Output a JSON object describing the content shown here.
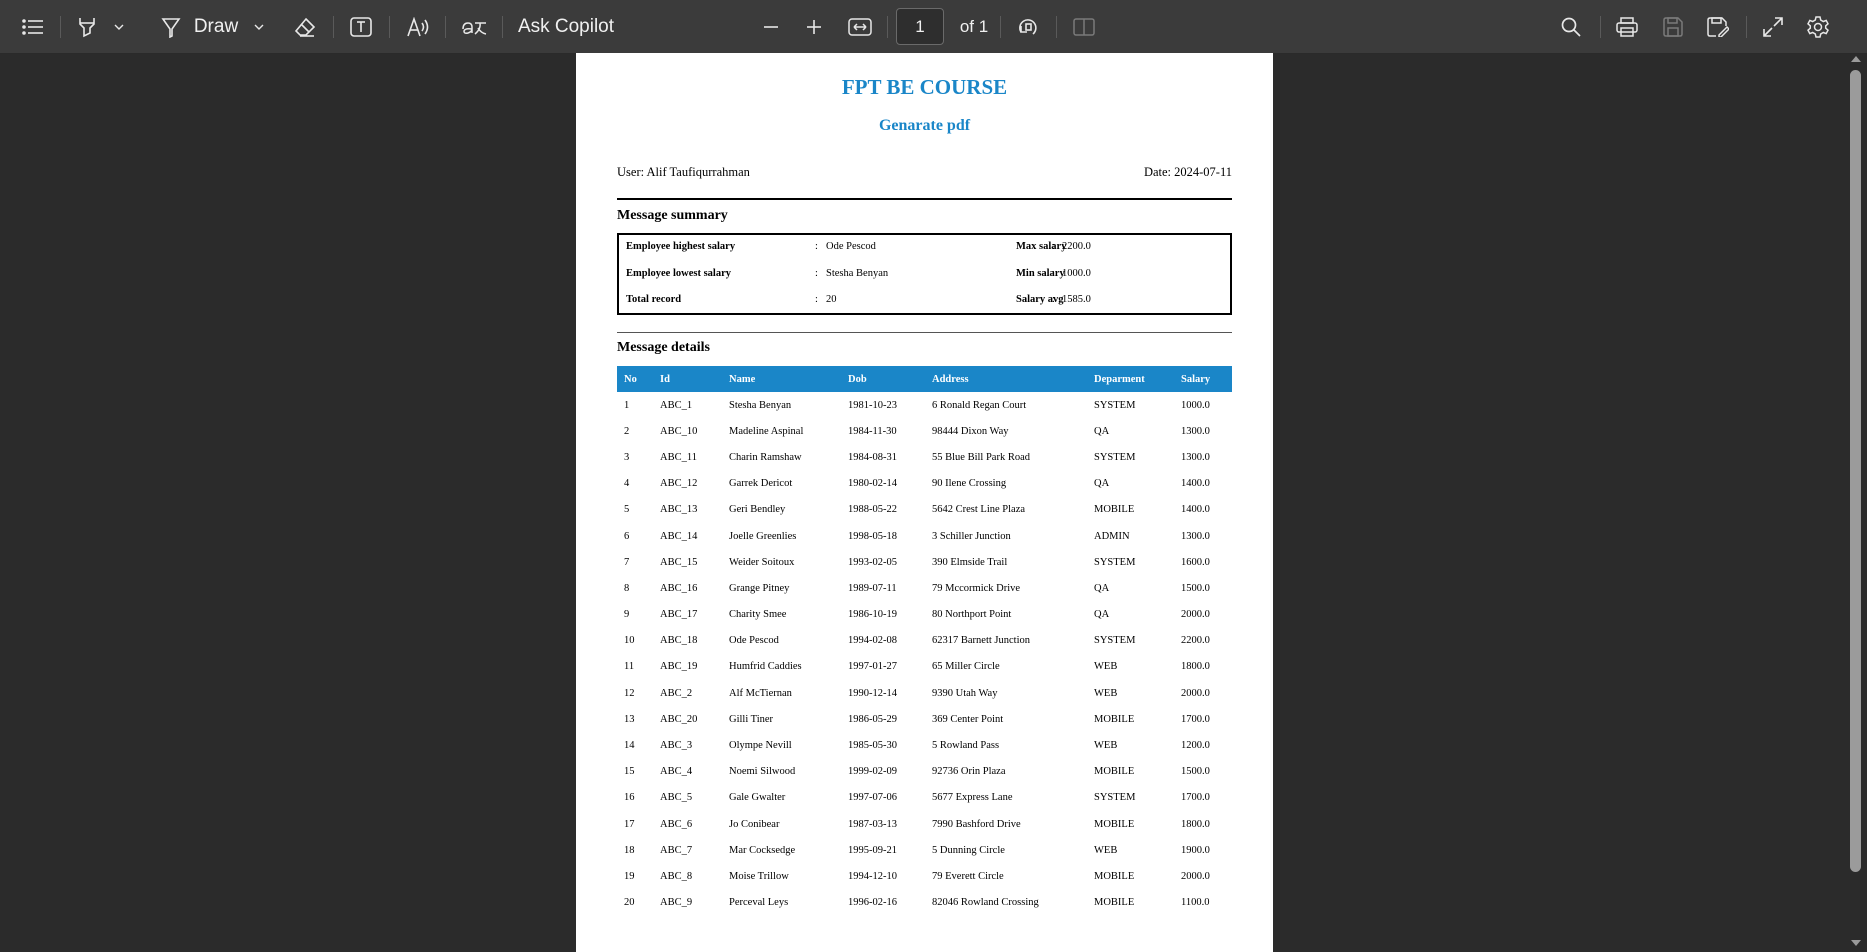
{
  "toolbar": {
    "draw_label": "Draw",
    "ask_copilot_label": "Ask Copilot",
    "page_current": "1",
    "page_total_label": "of 1"
  },
  "document": {
    "title": "FPT BE COURSE",
    "subtitle": "Genarate pdf",
    "user_label": "User: Alif Taufiqurrahman",
    "date_label": "Date: 2024-07-11",
    "summary_heading": "Message summary",
    "summary": {
      "highest_label": "Employee highest salary",
      "highest_value": "Ode Pescod",
      "max_label": "Max salary",
      "max_value": "2200.0",
      "lowest_label": "Employee lowest salary",
      "lowest_value": "Stesha Benyan",
      "min_label": "Min salary",
      "min_value": "1000.0",
      "total_label": "Total record",
      "total_value": "20",
      "avg_label": "Salary avg",
      "avg_value": "1585.0",
      "separator": ":"
    },
    "details_heading": "Message details",
    "columns": [
      "No",
      "Id",
      "Name",
      "Dob",
      "Address",
      "Deparment",
      "Salary"
    ],
    "rows": [
      [
        "1",
        "ABC_1",
        "Stesha Benyan",
        "1981-10-23",
        "6 Ronald Regan Court",
        "SYSTEM",
        "1000.0"
      ],
      [
        "2",
        "ABC_10",
        "Madeline Aspinal",
        "1984-11-30",
        "98444 Dixon Way",
        "QA",
        "1300.0"
      ],
      [
        "3",
        "ABC_11",
        "Charin Ramshaw",
        "1984-08-31",
        "55 Blue Bill Park Road",
        "SYSTEM",
        "1300.0"
      ],
      [
        "4",
        "ABC_12",
        "Garrek Dericot",
        "1980-02-14",
        "90 Ilene Crossing",
        "QA",
        "1400.0"
      ],
      [
        "5",
        "ABC_13",
        "Geri Bendley",
        "1988-05-22",
        "5642 Crest Line Plaza",
        "MOBILE",
        "1400.0"
      ],
      [
        "6",
        "ABC_14",
        "Joelle Greenlies",
        "1998-05-18",
        "3 Schiller Junction",
        "ADMIN",
        "1300.0"
      ],
      [
        "7",
        "ABC_15",
        "Weider Soitoux",
        "1993-02-05",
        "390 Elmside Trail",
        "SYSTEM",
        "1600.0"
      ],
      [
        "8",
        "ABC_16",
        "Grange Pitney",
        "1989-07-11",
        "79 Mccormick Drive",
        "QA",
        "1500.0"
      ],
      [
        "9",
        "ABC_17",
        "Charity Smee",
        "1986-10-19",
        "80 Northport Point",
        "QA",
        "2000.0"
      ],
      [
        "10",
        "ABC_18",
        "Ode Pescod",
        "1994-02-08",
        "62317 Barnett Junction",
        "SYSTEM",
        "2200.0"
      ],
      [
        "11",
        "ABC_19",
        "Humfrid Caddies",
        "1997-01-27",
        "65 Miller Circle",
        "WEB",
        "1800.0"
      ],
      [
        "12",
        "ABC_2",
        "Alf McTiernan",
        "1990-12-14",
        "9390 Utah Way",
        "WEB",
        "2000.0"
      ],
      [
        "13",
        "ABC_20",
        "Gilli Tiner",
        "1986-05-29",
        "369 Center Point",
        "MOBILE",
        "1700.0"
      ],
      [
        "14",
        "ABC_3",
        "Olympe Nevill",
        "1985-05-30",
        "5 Rowland Pass",
        "WEB",
        "1200.0"
      ],
      [
        "15",
        "ABC_4",
        "Noemi Silwood",
        "1999-02-09",
        "92736 Orin Plaza",
        "MOBILE",
        "1500.0"
      ],
      [
        "16",
        "ABC_5",
        "Gale Gwalter",
        "1997-07-06",
        "5677 Express Lane",
        "SYSTEM",
        "1700.0"
      ],
      [
        "17",
        "ABC_6",
        "Jo Conibear",
        "1987-03-13",
        "7990 Bashford Drive",
        "MOBILE",
        "1800.0"
      ],
      [
        "18",
        "ABC_7",
        "Mar Cocksedge",
        "1995-09-21",
        "5 Dunning Circle",
        "WEB",
        "1900.0"
      ],
      [
        "19",
        "ABC_8",
        "Moise Trillow",
        "1994-12-10",
        "79 Everett Circle",
        "MOBILE",
        "2000.0"
      ],
      [
        "20",
        "ABC_9",
        "Perceval Leys",
        "1996-02-16",
        "82046 Rowland Crossing",
        "MOBILE",
        "1100.0"
      ]
    ]
  },
  "colors": {
    "accent": "#1a86c8",
    "toolbar_bg": "#3b3b3b",
    "viewer_bg": "#2b2b2b"
  },
  "icons": [
    "contents-icon",
    "highlight-icon",
    "chevron-down-icon",
    "draw-icon",
    "eraser-icon",
    "text-box-icon",
    "read-aloud-icon",
    "translate-icon",
    "zoom-out-icon",
    "zoom-in-icon",
    "fit-page-icon",
    "rotate-icon",
    "page-view-icon",
    "search-icon",
    "print-icon",
    "save-icon",
    "save-as-icon",
    "fullscreen-icon",
    "settings-icon"
  ]
}
